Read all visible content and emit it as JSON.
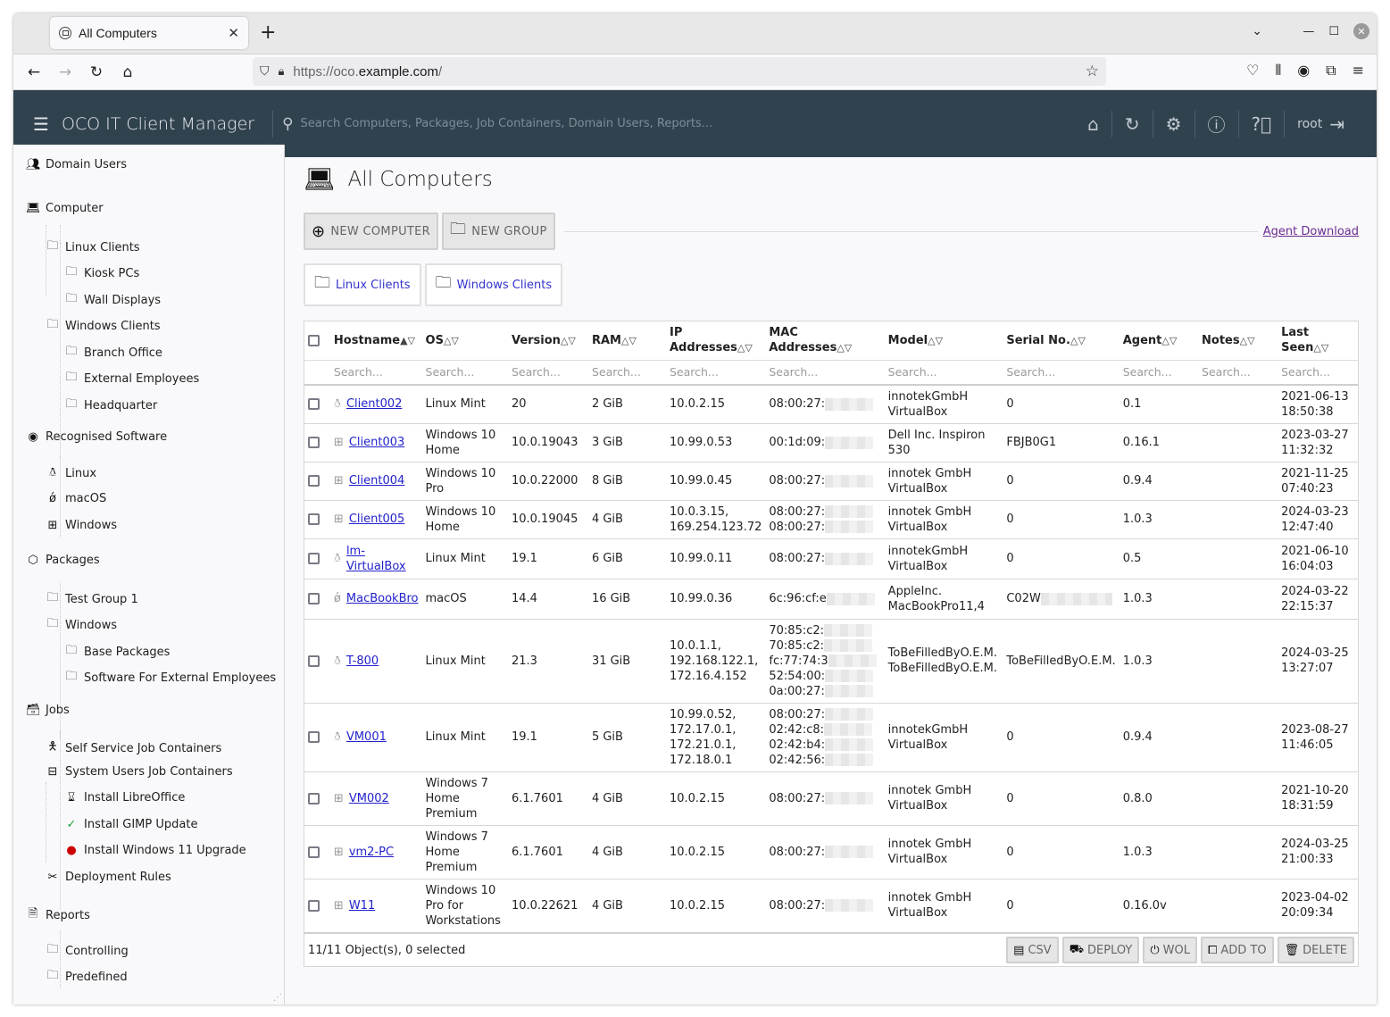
{
  "browser": {
    "tab_title": "All Computers",
    "url_prefix": "https://oco.",
    "url_domain": "example.com",
    "url_suffix": "/"
  },
  "app": {
    "title": "OCO IT Client Manager",
    "search_placeholder": "Search Computers, Packages, Job Containers, Domain Users, Reports...",
    "username": "root"
  },
  "sidebar": {
    "items": [
      {
        "label": "Domain Users",
        "icon": "users-icon"
      },
      {
        "label": "Computer",
        "icon": "laptop-icon"
      },
      {
        "label": "Linux Clients",
        "icon": "folder-icon"
      },
      {
        "label": "Kiosk PCs",
        "icon": "folder-icon"
      },
      {
        "label": "Wall Displays",
        "icon": "folder-icon"
      },
      {
        "label": "Windows Clients",
        "icon": "folder-icon"
      },
      {
        "label": "Branch Office",
        "icon": "folder-icon"
      },
      {
        "label": "External Employees",
        "icon": "folder-icon"
      },
      {
        "label": "Headquarter",
        "icon": "folder-icon"
      },
      {
        "label": "Recognised Software",
        "icon": "radio-icon"
      },
      {
        "label": "Linux",
        "icon": "linux-icon"
      },
      {
        "label": "macOS",
        "icon": "apple-icon"
      },
      {
        "label": "Windows",
        "icon": "windows-icon"
      },
      {
        "label": "Packages",
        "icon": "package-icon"
      },
      {
        "label": "Test Group 1",
        "icon": "folder-icon"
      },
      {
        "label": "Windows",
        "icon": "folder-icon"
      },
      {
        "label": "Base Packages",
        "icon": "folder-icon"
      },
      {
        "label": "Software For External Employees",
        "icon": "folder-icon"
      },
      {
        "label": "Jobs",
        "icon": "briefcase-icon"
      },
      {
        "label": "Self Service Job Containers",
        "icon": "person-icon"
      },
      {
        "label": "System Users Job Containers",
        "icon": "archive-icon"
      },
      {
        "label": "Install LibreOffice",
        "icon": "hourglass-icon"
      },
      {
        "label": "Install GIMP Update",
        "icon": "check-icon"
      },
      {
        "label": "Install Windows 11 Upgrade",
        "icon": "error-icon"
      },
      {
        "label": "Deployment Rules",
        "icon": "tools-icon"
      },
      {
        "label": "Reports",
        "icon": "report-icon"
      },
      {
        "label": "Controlling",
        "icon": "folder-icon"
      },
      {
        "label": "Predefined",
        "icon": "folder-icon"
      }
    ]
  },
  "main": {
    "title": "All Computers",
    "new_computer": "NEW COMPUTER",
    "new_group": "NEW GROUP",
    "agent_download": "Agent Download",
    "groups": [
      "Linux Clients",
      "Windows Clients"
    ],
    "columns": [
      "Hostname",
      "OS",
      "Version",
      "RAM",
      "IP Addresses",
      "MAC Addresses",
      "Model",
      "Serial No.",
      "Agent",
      "Notes",
      "Last Seen"
    ],
    "sort_asc_active": "▲▽",
    "sort_inactive": "△▽",
    "search_placeholder": "Search...",
    "rows": [
      {
        "hostname": "Client002",
        "os_type": "linux",
        "os": "Linux Mint",
        "version": "20",
        "ram": "2 GiB",
        "ip": [
          "10.0.2.15"
        ],
        "mac": [
          "08:00:27:"
        ],
        "model": [
          "innotekGmbH",
          "VirtualBox"
        ],
        "serial": "0",
        "agent": "0.1",
        "notes": "",
        "last_seen": [
          "2021-06-13",
          "18:50:38"
        ]
      },
      {
        "hostname": "Client003",
        "os_type": "windows",
        "os": "Windows 10 Home",
        "version": "10.0.19043",
        "ram": "3 GiB",
        "ip": [
          "10.99.0.53"
        ],
        "mac": [
          "00:1d:09:"
        ],
        "model": [
          "Dell Inc. Inspiron",
          "530"
        ],
        "serial": "FBJB0G1",
        "agent": "0.16.1",
        "notes": "",
        "last_seen": [
          "2023-03-27",
          "11:32:32"
        ]
      },
      {
        "hostname": "Client004",
        "os_type": "windows",
        "os": "Windows 10 Pro",
        "version": "10.0.22000",
        "ram": "8 GiB",
        "ip": [
          "10.99.0.45"
        ],
        "mac": [
          "08:00:27:"
        ],
        "model": [
          "innotek GmbH",
          "VirtualBox"
        ],
        "serial": "0",
        "agent": "0.9.4",
        "notes": "",
        "last_seen": [
          "2021-11-25",
          "07:40:23"
        ]
      },
      {
        "hostname": "Client005",
        "os_type": "windows",
        "os": "Windows 10 Home",
        "version": "10.0.19045",
        "ram": "4 GiB",
        "ip": [
          "10.0.3.15,",
          "169.254.123.72"
        ],
        "mac": [
          "08:00:27:",
          "08:00:27:"
        ],
        "model": [
          "innotek GmbH",
          "VirtualBox"
        ],
        "serial": "0",
        "agent": "1.0.3",
        "notes": "",
        "last_seen": [
          "2024-03-23",
          "12:47:40"
        ]
      },
      {
        "hostname": "lm-VirtualBox",
        "os_type": "linux",
        "os": "Linux Mint",
        "version": "19.1",
        "ram": "6 GiB",
        "ip": [
          "10.99.0.11"
        ],
        "mac": [
          "08:00:27:"
        ],
        "model": [
          "innotekGmbH",
          "VirtualBox"
        ],
        "serial": "0",
        "agent": "0.5",
        "notes": "",
        "last_seen": [
          "2021-06-10",
          "16:04:03"
        ]
      },
      {
        "hostname": "MacBookBro",
        "os_type": "mac",
        "os": "macOS",
        "version": "14.4",
        "ram": "16 GiB",
        "ip": [
          "10.99.0.36"
        ],
        "mac": [
          "6c:96:cf:e"
        ],
        "model": [
          "AppleInc.",
          "MacBookPro11,4"
        ],
        "serial": "C02W",
        "agent": "1.0.3",
        "notes": "",
        "last_seen": [
          "2024-03-22",
          "22:15:37"
        ]
      },
      {
        "hostname": "T-800",
        "os_type": "linux",
        "os": "Linux Mint",
        "version": "21.3",
        "ram": "31 GiB",
        "ip": [
          "10.0.1.1,",
          "192.168.122.1,",
          "172.16.4.152"
        ],
        "mac": [
          "70:85:c2:",
          "70:85:c2:",
          "fc:77:74:3",
          "52:54:00:",
          "0a:00:27:"
        ],
        "model": [
          "ToBeFilledByO.E.M.",
          "ToBeFilledByO.E.M."
        ],
        "serial": "ToBeFilledByO.E.M.",
        "agent": "1.0.3",
        "notes": "",
        "last_seen": [
          "2024-03-25",
          "13:27:07"
        ]
      },
      {
        "hostname": "VM001",
        "os_type": "linux",
        "os": "Linux Mint",
        "version": "19.1",
        "ram": "5 GiB",
        "ip": [
          "10.99.0.52,",
          "172.17.0.1,",
          "172.21.0.1,",
          "172.18.0.1"
        ],
        "mac": [
          "08:00:27:",
          "02:42:c8:",
          "02:42:b4:",
          "02:42:56:"
        ],
        "model": [
          "innotekGmbH",
          "VirtualBox"
        ],
        "serial": "0",
        "agent": "0.9.4",
        "notes": "",
        "last_seen": [
          "2023-08-27",
          "11:46:05"
        ]
      },
      {
        "hostname": "VM002",
        "os_type": "windows",
        "os": "Windows 7 Home Premium",
        "version": "6.1.7601",
        "ram": "4 GiB",
        "ip": [
          "10.0.2.15"
        ],
        "mac": [
          "08:00:27:"
        ],
        "model": [
          "innotek GmbH",
          "VirtualBox"
        ],
        "serial": "0",
        "agent": "0.8.0",
        "notes": "",
        "last_seen": [
          "2021-10-20",
          "18:31:59"
        ]
      },
      {
        "hostname": "vm2-PC",
        "os_type": "windows",
        "os": "Windows 7 Home Premium",
        "version": "6.1.7601",
        "ram": "4 GiB",
        "ip": [
          "10.0.2.15"
        ],
        "mac": [
          "08:00:27:"
        ],
        "model": [
          "innotek GmbH",
          "VirtualBox"
        ],
        "serial": "0",
        "agent": "1.0.3",
        "notes": "",
        "last_seen": [
          "2024-03-25",
          "21:00:33"
        ]
      },
      {
        "hostname": "W11",
        "os_type": "windows",
        "os": "Windows 10 Pro for Workstations",
        "version": "10.0.22621",
        "ram": "4 GiB",
        "ip": [
          "10.0.2.15"
        ],
        "mac": [
          "08:00:27:"
        ],
        "model": [
          "innotek GmbH",
          "VirtualBox"
        ],
        "serial": "0",
        "agent": "0.16.0v",
        "notes": "",
        "last_seen": [
          "2023-04-02",
          "20:09:34"
        ]
      }
    ],
    "footer_count": "11/11 Object(s), 0 selected",
    "footer_buttons": [
      "CSV",
      "DEPLOY",
      "WOL",
      "ADD TO",
      "DELETE"
    ]
  },
  "colors": {
    "header_bg": "#31424f",
    "link": "#2222cc",
    "agent_download": "#6b2b91",
    "error": "#cc0000",
    "success": "#1e9e3a"
  }
}
